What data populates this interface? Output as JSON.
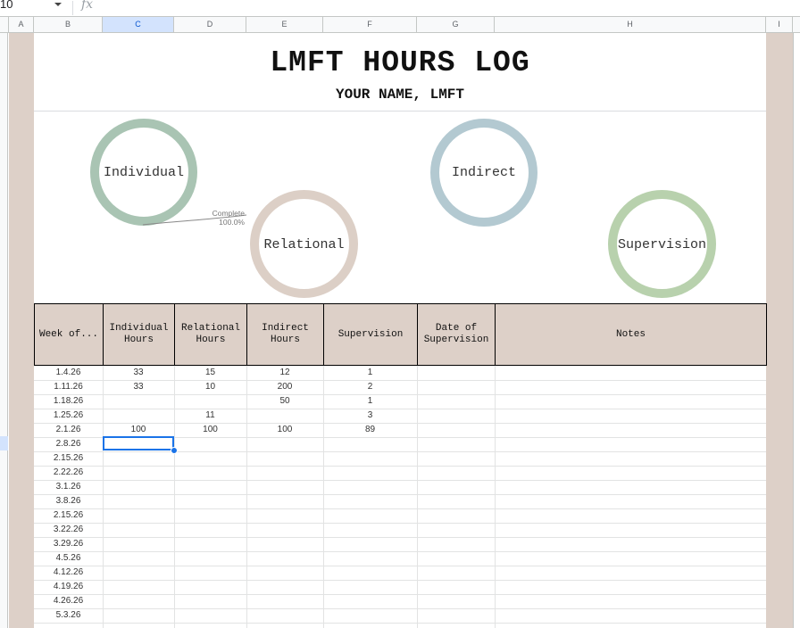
{
  "formula_bar": {
    "name_box": "10",
    "fx_label": "fx"
  },
  "columns": [
    "A",
    "B",
    "C",
    "D",
    "E",
    "F",
    "G",
    "H",
    "I"
  ],
  "selected_column": "C",
  "header": {
    "title": "LMFT HOURS LOG",
    "subtitle": "YOUR NAME, LMFT"
  },
  "charts": {
    "individual": {
      "label": "Individual",
      "color": "#a9c4b3"
    },
    "relational": {
      "label": "Relational",
      "color": "#dccfc6"
    },
    "indirect": {
      "label": "Indirect",
      "color": "#b3c9d1"
    },
    "supervision": {
      "label": "Supervision",
      "color": "#b8d1ad"
    },
    "callout": {
      "label": "Complete",
      "value": "100.0%"
    }
  },
  "table": {
    "headers": [
      "Week of...",
      "Individual Hours",
      "Relational Hours",
      "Indirect Hours",
      "Supervision",
      "Date of Supervision",
      "Notes"
    ],
    "rows": [
      [
        "1.4.26",
        "33",
        "15",
        "12",
        "1",
        "",
        ""
      ],
      [
        "1.11.26",
        "33",
        "10",
        "200",
        "2",
        "",
        ""
      ],
      [
        "1.18.26",
        "",
        "",
        "50",
        "1",
        "",
        ""
      ],
      [
        "1.25.26",
        "",
        "11",
        "",
        "3",
        "",
        ""
      ],
      [
        "2.1.26",
        "100",
        "100",
        "100",
        "89",
        "",
        ""
      ],
      [
        "2.8.26",
        "",
        "",
        "",
        "",
        "",
        ""
      ],
      [
        "2.15.26",
        "",
        "",
        "",
        "",
        "",
        ""
      ],
      [
        "2.22.26",
        "",
        "",
        "",
        "",
        "",
        ""
      ],
      [
        "3.1.26",
        "",
        "",
        "",
        "",
        "",
        ""
      ],
      [
        "3.8.26",
        "",
        "",
        "",
        "",
        "",
        ""
      ],
      [
        "2.15.26",
        "",
        "",
        "",
        "",
        "",
        ""
      ],
      [
        "3.22.26",
        "",
        "",
        "",
        "",
        "",
        ""
      ],
      [
        "3.29.26",
        "",
        "",
        "",
        "",
        "",
        ""
      ],
      [
        "4.5.26",
        "",
        "",
        "",
        "",
        "",
        ""
      ],
      [
        "4.12.26",
        "",
        "",
        "",
        "",
        "",
        ""
      ],
      [
        "4.19.26",
        "",
        "",
        "",
        "",
        "",
        ""
      ],
      [
        "4.26.26",
        "",
        "",
        "",
        "",
        "",
        ""
      ],
      [
        "5.3.26",
        "",
        "",
        "",
        "",
        "",
        ""
      ]
    ]
  },
  "colors": {
    "accent_tan": "#ddd0c8",
    "selection_blue": "#1a73e8"
  }
}
